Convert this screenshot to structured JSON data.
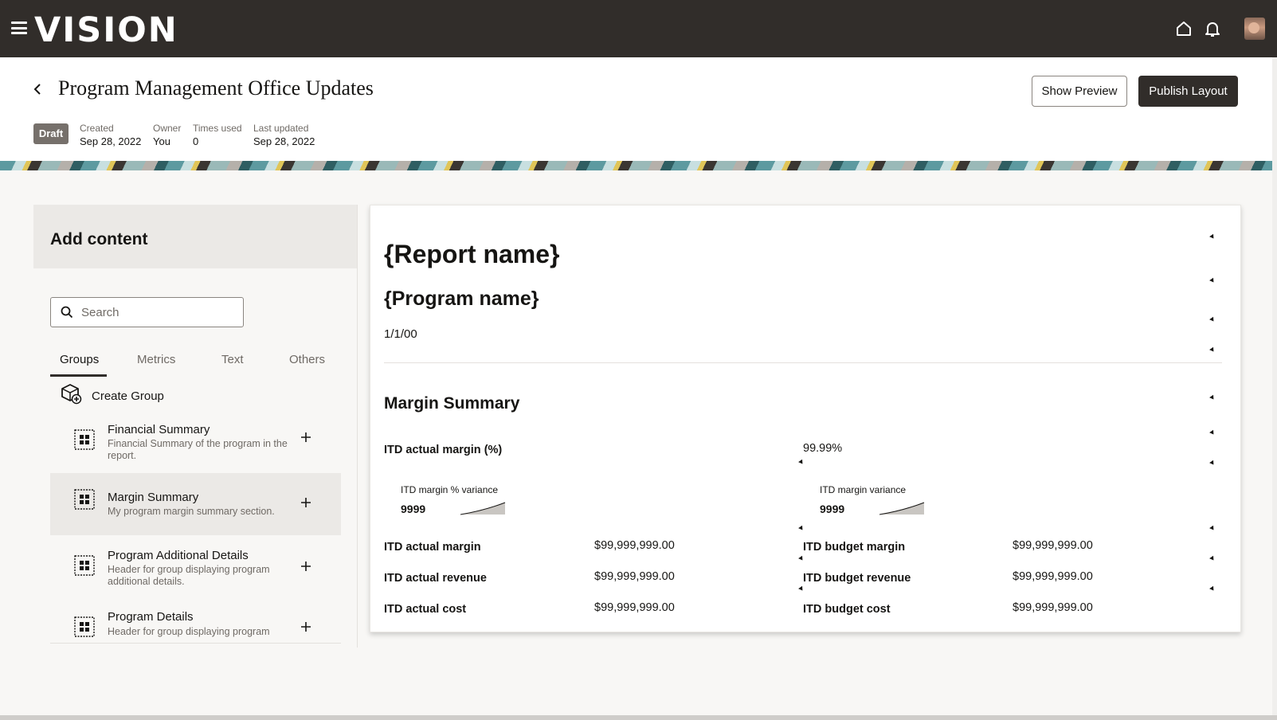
{
  "app": {
    "logo": "VISION"
  },
  "topbar": {
    "icons": [
      "menu-icon",
      "home-icon",
      "bell-icon",
      "avatar"
    ]
  },
  "header": {
    "title": "Program Management Office Updates",
    "status": "Draft",
    "meta": [
      {
        "label": "Created",
        "value": "Sep 28, 2022"
      },
      {
        "label": "Owner",
        "value": "You"
      },
      {
        "label": "Times used",
        "value": "0"
      },
      {
        "label": "Last updated",
        "value": "Sep 28, 2022"
      }
    ],
    "show_preview": "Show Preview",
    "publish_layout": "Publish Layout"
  },
  "panel": {
    "title": "Add content",
    "search_placeholder": "Search",
    "tabs": [
      "Groups",
      "Metrics",
      "Text",
      "Others"
    ],
    "active_tab": "Groups",
    "create_group": "Create Group",
    "items": [
      {
        "name": "Financial Summary",
        "description": "Financial Summary of the program in the report."
      },
      {
        "name": "Margin Summary",
        "description": "My program margin summary section."
      },
      {
        "name": "Program Additional Details",
        "description": "Header for group displaying program additional details."
      },
      {
        "name": "Program Details",
        "description": "Header for group displaying program"
      }
    ],
    "selected_item": "Margin Summary"
  },
  "canvas": {
    "report_name": "{Report name}",
    "program_name": "{Program name}",
    "date": "1/1/00",
    "section_title": "Margin Summary",
    "itd_actual_margin_pct_label": "ITD actual margin (%)",
    "itd_actual_margin_pct_value": "99.99%",
    "variance_cards": [
      {
        "label": "ITD margin % variance",
        "value": "9999"
      },
      {
        "label": "ITD margin variance",
        "value": "9999"
      }
    ],
    "rows_left": [
      {
        "label": "ITD actual margin",
        "value": "$99,999,999.00"
      },
      {
        "label": "ITD actual revenue",
        "value": "$99,999,999.00"
      },
      {
        "label": "ITD actual cost",
        "value": "$99,999,999.00"
      }
    ],
    "rows_right": [
      {
        "label": "ITD budget margin",
        "value": "$99,999,999.00"
      },
      {
        "label": "ITD budget revenue",
        "value": "$99,999,999.00"
      },
      {
        "label": "ITD budget cost",
        "value": "$99,999,999.00"
      }
    ]
  },
  "colors": {
    "topbar": "#312d2a",
    "primary_button": "#312d2a",
    "badge": "#76706b",
    "selected_row": "#ebe9e6"
  }
}
